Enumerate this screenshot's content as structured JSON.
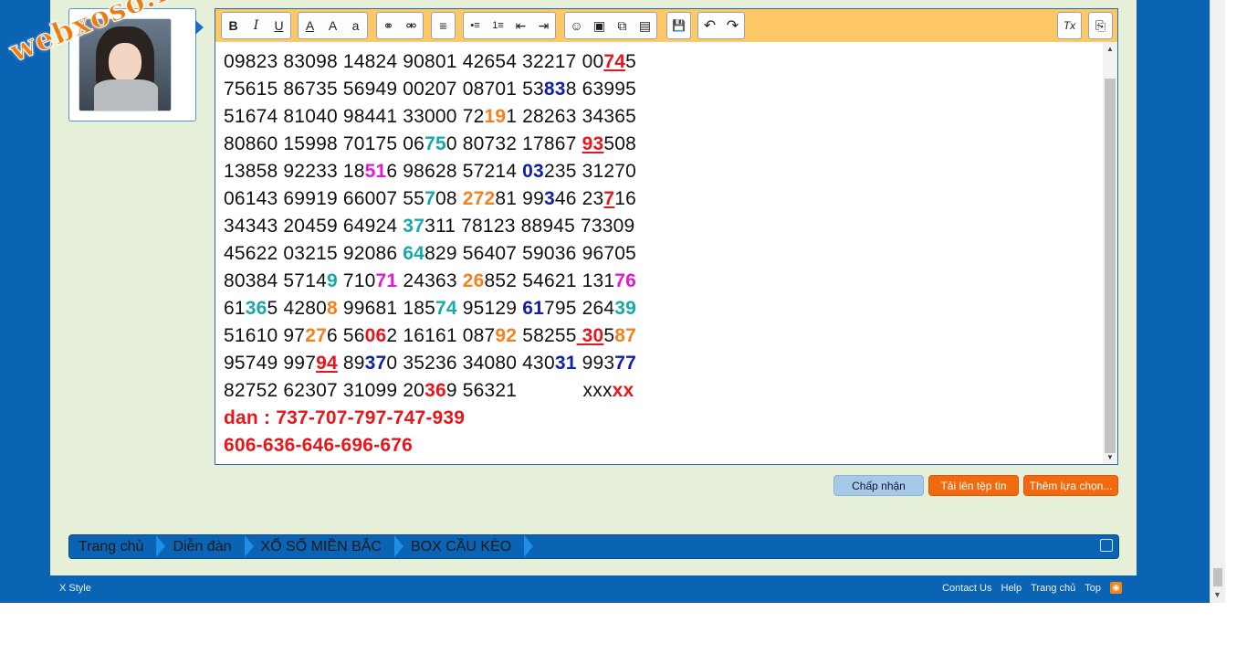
{
  "watermark": "webxoso.net",
  "editor": {
    "toolbar": {
      "bold": "B",
      "italic": "I",
      "underline": "U",
      "font_color": "A",
      "font_size": "A",
      "font_family": "a",
      "link": "⚭",
      "unlink": "⚮",
      "align": "≡",
      "bullets": "•≡",
      "numbers": "1≡",
      "outdent": "⇤",
      "indent": "⇥",
      "smiley": "☺",
      "image": "▣",
      "media": "⧉",
      "quote": "▤",
      "save": "💾",
      "undo": "↶",
      "redo": "↷",
      "remove_format": "Tx",
      "toggle": "⎘"
    },
    "lines": [
      [
        {
          "t": "09823 83098 14824 90801 42654 32217 00"
        },
        {
          "t": "74",
          "c": "red b ul"
        },
        {
          "t": "5"
        }
      ],
      [
        {
          "t": "75615 86735 56949 00207 08701 53"
        },
        {
          "t": "83",
          "c": "blue b"
        },
        {
          "t": "8 63995"
        }
      ],
      [
        {
          "t": "51674 81040 98441 33000 72"
        },
        {
          "t": "19",
          "c": "orange b"
        },
        {
          "t": "1 28263 34365"
        }
      ],
      [
        {
          "t": "80860 15998 70175 06"
        },
        {
          "t": "75",
          "c": "teal b"
        },
        {
          "t": "0 80732 17867 "
        },
        {
          "t": "93",
          "c": "red b ul"
        },
        {
          "t": "508"
        }
      ],
      [
        {
          "t": "13858 92233 18"
        },
        {
          "t": "51",
          "c": "magenta b"
        },
        {
          "t": "6 98628 57214 "
        },
        {
          "t": "03",
          "c": "blue b"
        },
        {
          "t": "235 31270"
        }
      ],
      [
        {
          "t": "06143 69919 66007 55"
        },
        {
          "t": "7",
          "c": "teal b"
        },
        {
          "t": "08 "
        },
        {
          "t": "272",
          "c": "orange b"
        },
        {
          "t": "81 99"
        },
        {
          "t": "3",
          "c": "blue b"
        },
        {
          "t": "46 23"
        },
        {
          "t": "7",
          "c": "red b ul"
        },
        {
          "t": "16"
        }
      ],
      [
        {
          "t": "34343 20459 64924 "
        },
        {
          "t": "37",
          "c": "teal b"
        },
        {
          "t": "311 78123 88945 73309"
        }
      ],
      [
        {
          "t": "45622 03215 92086 "
        },
        {
          "t": "64",
          "c": "teal b"
        },
        {
          "t": "829 56407 59036 96705"
        }
      ],
      [
        {
          "t": "80384 5714"
        },
        {
          "t": "9",
          "c": "teal b"
        },
        {
          "t": " 710"
        },
        {
          "t": "71",
          "c": "magenta b"
        },
        {
          "t": " 24363 "
        },
        {
          "t": "26",
          "c": "orange b"
        },
        {
          "t": "852 54621 131"
        },
        {
          "t": "76",
          "c": "magenta b"
        }
      ],
      [
        {
          "t": "61"
        },
        {
          "t": "36",
          "c": "teal b"
        },
        {
          "t": "5 4280"
        },
        {
          "t": "8",
          "c": "orange b"
        },
        {
          "t": " 99681 185"
        },
        {
          "t": "74",
          "c": "teal b"
        },
        {
          "t": " 95129 "
        },
        {
          "t": "61",
          "c": "blue b"
        },
        {
          "t": "795 264"
        },
        {
          "t": "39",
          "c": "teal b"
        }
      ],
      [
        {
          "t": "51610 97"
        },
        {
          "t": "27",
          "c": "orange b"
        },
        {
          "t": "6 56"
        },
        {
          "t": "06",
          "c": "red b"
        },
        {
          "t": "2 16161 087"
        },
        {
          "t": "92",
          "c": "orange b"
        },
        {
          "t": " 58255"
        },
        {
          "t": " 30",
          "c": "red b ul"
        },
        {
          "t": "5"
        },
        {
          "t": "87",
          "c": "orange b"
        }
      ],
      [
        {
          "t": "95749 997"
        },
        {
          "t": "94",
          "c": "red b ul"
        },
        {
          "t": " 89"
        },
        {
          "t": "37",
          "c": "blue b"
        },
        {
          "t": "0 35236 34080 430"
        },
        {
          "t": "31",
          "c": "blue b"
        },
        {
          "t": " 993"
        },
        {
          "t": "77",
          "c": "blue b"
        }
      ],
      [
        {
          "t": "82752 62307 31099 20"
        },
        {
          "t": "36",
          "c": "red b"
        },
        {
          "t": "9 56321            xxx"
        },
        {
          "t": "xx",
          "c": "red b"
        }
      ],
      [
        {
          "t": "dan : 737-707-797-747-939",
          "c": "dan"
        }
      ],
      [
        {
          "t": "606-636-646-696-676",
          "c": "dan"
        }
      ]
    ]
  },
  "buttons": {
    "accept": "Chấp nhận",
    "upload": "Tải lên tệp tin",
    "more": "Thêm lựa chọn..."
  },
  "breadcrumb": [
    "Trang chủ",
    "Diễn đàn",
    "XỔ SỐ MIỀN BẮC",
    "BOX CẦU KÈO"
  ],
  "footer": {
    "style": "X Style",
    "links": [
      "Contact Us",
      "Help",
      "Trang chủ",
      "Top"
    ]
  },
  "colors": {
    "accent_blue": "#0b63b3",
    "panel_bg": "#e6f0d8",
    "toolbar_bg": "#ffc866",
    "highlight_red": "#e8151b",
    "highlight_blue": "#1020a8",
    "highlight_teal": "#17a9a9",
    "highlight_orange": "#f3811d",
    "highlight_magenta": "#e21ad8"
  }
}
